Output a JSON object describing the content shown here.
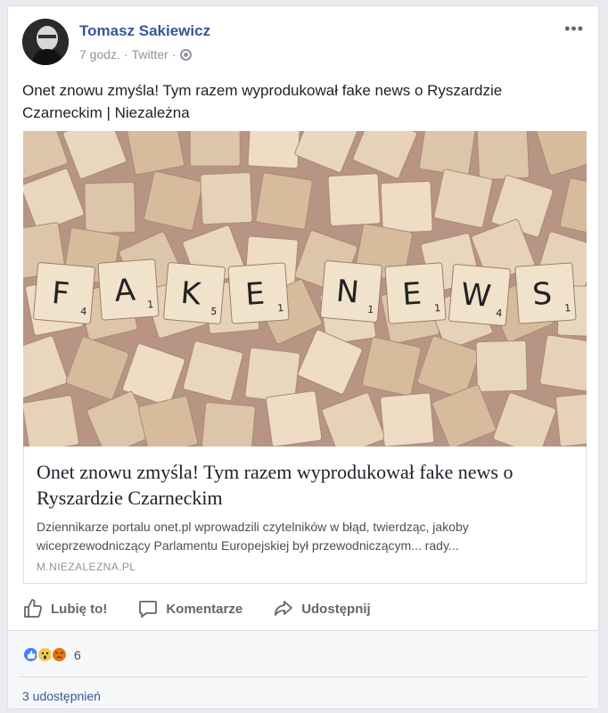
{
  "post": {
    "author": "Tomasz Sakiewicz",
    "time": "7 godz.",
    "separator": "·",
    "source": "Twitter",
    "text": "Onet znowu zmyśla! Tym razem wyprodukował fake news o Ryszardzie Czarneckim | Niezależna"
  },
  "image": {
    "tiles": [
      "F",
      "A",
      "K",
      "E",
      "N",
      "E",
      "W",
      "S"
    ],
    "scores": [
      "4",
      "1",
      "5",
      "1",
      "1",
      "1",
      "4",
      "1"
    ]
  },
  "link": {
    "title": "Onet znowu zmyśla! Tym razem wyprodukował fake news o Ryszardzie Czarneckim",
    "description": "Dziennikarze portalu onet.pl wprowadzili czytelników w błąd, twierdząc, jakoby wiceprzewodniczący Parlamentu Europejskiej był przewodniczącym... rady...",
    "domain": "M.NIEZALEZNA.PL"
  },
  "actions": {
    "like": "Lubię to!",
    "comment": "Komentarze",
    "share": "Udostępnij"
  },
  "reactions": {
    "count": "6",
    "types": [
      "like-icon",
      "wow-icon",
      "angry-icon"
    ]
  },
  "shares": "3 udostępnień",
  "colors": {
    "link_blue": "#365899",
    "like_blue": "#4080ff",
    "muted": "#90949c"
  }
}
